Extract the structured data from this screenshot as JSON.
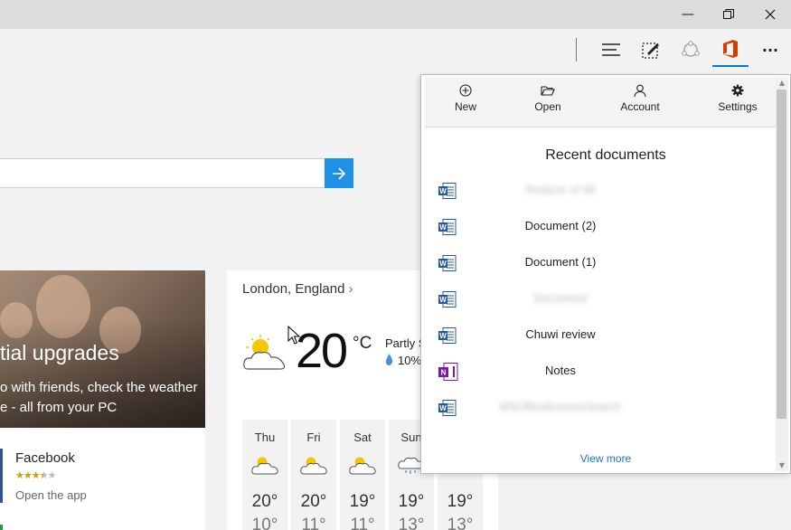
{
  "window": {
    "minimize_glyph": "—",
    "maximize_glyph": "❐",
    "close_glyph": "✕"
  },
  "toolbar": {
    "more_glyph": "···"
  },
  "office_flyout": {
    "header": [
      {
        "label": "New",
        "icon": "plus-circle-icon"
      },
      {
        "label": "Open",
        "icon": "folder-open-icon"
      },
      {
        "label": "Account",
        "icon": "person-icon"
      },
      {
        "label": "Settings",
        "icon": "gear-icon"
      }
    ],
    "recent_title": "Recent documents",
    "documents": [
      {
        "name": "Reduce of 96",
        "type": "word",
        "blurred": true
      },
      {
        "name": "Document (2)",
        "type": "word",
        "blurred": false
      },
      {
        "name": "Document (1)",
        "type": "word",
        "blurred": false
      },
      {
        "name": "Document",
        "type": "word",
        "blurred": true
      },
      {
        "name": "Chuwi review",
        "type": "word",
        "blurred": false
      },
      {
        "name": "Notes",
        "type": "onenote",
        "blurred": false
      },
      {
        "name": "MSOfficelicenceSearch",
        "type": "word",
        "blurred": true
      }
    ],
    "view_more": "View more"
  },
  "news": {
    "headline": "tial upgrades",
    "line1": "o with friends, check the weather",
    "line2": "e - all from your PC"
  },
  "app_card": {
    "name": "Facebook",
    "stars": "★★★★★",
    "rating": 3.5,
    "action": "Open the app"
  },
  "weather": {
    "location": "London, England",
    "chevron": "›",
    "temperature": "20",
    "unit": "°C",
    "condition": "Partly S",
    "precip": "10%",
    "forecast": [
      {
        "day": "Thu",
        "high": "20°",
        "low": "10°"
      },
      {
        "day": "Fri",
        "high": "20°",
        "low": "11°"
      },
      {
        "day": "Sat",
        "high": "19°",
        "low": "11°"
      },
      {
        "day": "Sun",
        "high": "19°",
        "low": "13°"
      },
      {
        "day": "",
        "high": "19°",
        "low": "13°"
      }
    ]
  },
  "colors": {
    "accent": "#0078d7",
    "office_red": "#d83b01",
    "word_blue": "#2b579a",
    "onenote_purple": "#7719aa",
    "link": "#1976c8"
  }
}
